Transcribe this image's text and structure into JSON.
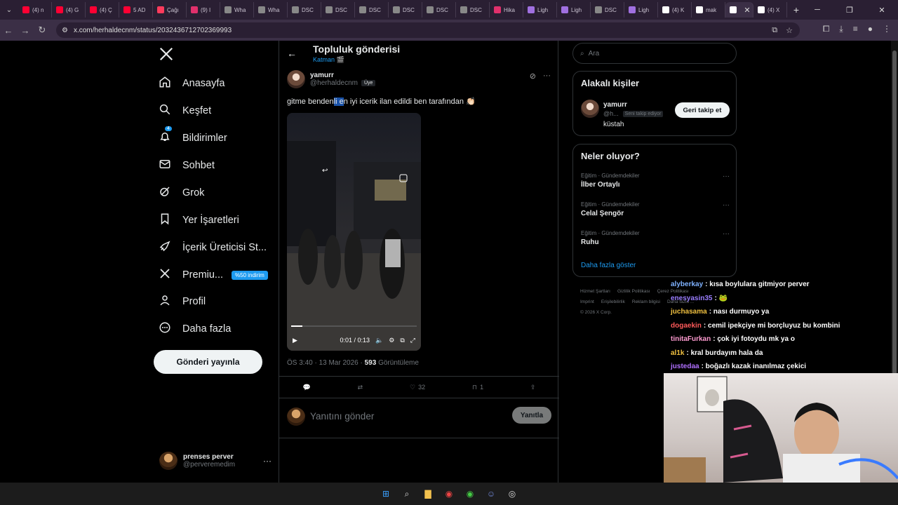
{
  "browser": {
    "tabs": [
      {
        "label": "(4) n",
        "color": "#ff0033"
      },
      {
        "label": "(4) G",
        "color": "#ff0033"
      },
      {
        "label": "(4) Ç",
        "color": "#ff0033"
      },
      {
        "label": "5 AD",
        "color": "#ff0033"
      },
      {
        "label": "Çağı",
        "color": "#ff3b5c"
      },
      {
        "label": "(9) I",
        "color": "#e1306c"
      },
      {
        "label": "Wha",
        "color": "#888888"
      },
      {
        "label": "Wha",
        "color": "#888888"
      },
      {
        "label": "DSC",
        "color": "#888888"
      },
      {
        "label": "DSC",
        "color": "#888888"
      },
      {
        "label": "DSC",
        "color": "#888888"
      },
      {
        "label": "DSC",
        "color": "#888888"
      },
      {
        "label": "DSC",
        "color": "#888888"
      },
      {
        "label": "DSC",
        "color": "#888888"
      },
      {
        "label": "Hika",
        "color": "#e1306c"
      },
      {
        "label": "Ligh",
        "color": "#a070e0"
      },
      {
        "label": "Ligh",
        "color": "#a070e0"
      },
      {
        "label": "DSC",
        "color": "#888888"
      },
      {
        "label": "Ligh",
        "color": "#a070e0"
      },
      {
        "label": "(4) K",
        "color": "#ffffff"
      },
      {
        "label": "mak",
        "color": "#ffffff"
      }
    ],
    "active_tab_label": "",
    "last_tab_label": "(4) X",
    "url": "x.com/herhaldecnm/status/2032436712702369993"
  },
  "nav": {
    "items": [
      {
        "label": "Anasayfa",
        "icon": "home-icon"
      },
      {
        "label": "Keşfet",
        "icon": "search-icon"
      },
      {
        "label": "Bildirimler",
        "icon": "bell-icon",
        "badge": "4"
      },
      {
        "label": "Sohbet",
        "icon": "mail-icon"
      },
      {
        "label": "Grok",
        "icon": "grok-icon"
      },
      {
        "label": "Yer İşaretleri",
        "icon": "bookmark-icon"
      },
      {
        "label": "İçerik Üreticisi St...",
        "icon": "rocket-icon"
      },
      {
        "label": "Premiu...",
        "icon": "x-icon",
        "pill": "%50 indirim"
      },
      {
        "label": "Profil",
        "icon": "person-icon"
      },
      {
        "label": "Daha fazla",
        "icon": "more-circle-icon"
      }
    ],
    "post_button": "Gönderi yayınla",
    "account": {
      "name": "prenses perver",
      "handle": "@perveremedim"
    }
  },
  "main": {
    "title": "Topluluk gönderisi",
    "subtitle": "Katman 🎬",
    "author": {
      "name": "yamurr",
      "handle": "@herhaldecnm",
      "member_badge": "Üye"
    },
    "text_before": "gitme benden",
    "text_selected": "li e",
    "text_after": "n iyi icerik ilan edildi ben tarafından 👏🏻",
    "video": {
      "time": "0:01 / 0:13",
      "progress": 0.09
    },
    "meta_time": "ÖS 3:40 · 13 Mar 2026 · ",
    "views": "593",
    "views_label": " Görüntüleme",
    "likes": "32",
    "bookmarks": "1",
    "reply_placeholder": "Yanıtını gönder",
    "reply_button": "Yanıtla"
  },
  "right": {
    "search_placeholder": "Ara",
    "related_title": "Alakalı kişiler",
    "person": {
      "name": "yamurr",
      "handle": "@h...",
      "follows_you": "Seni takip ediyor",
      "bio": "küstah",
      "button": "Geri takip et"
    },
    "trending_title": "Neler oluyor?",
    "trends": [
      {
        "category": "Eğitim · Gündemdekiler",
        "name": "İlber Ortaylı"
      },
      {
        "category": "Eğitim · Gündemdekiler",
        "name": "Celal Şengör"
      },
      {
        "category": "Eğitim · Gündemdekiler",
        "name": "Ruhu"
      }
    ],
    "show_more": "Daha fazla göster",
    "footer_line1": [
      "Hizmet Şartları",
      "Gizlilik Politikası",
      "Çerez Politikası"
    ],
    "footer_line2": [
      "Imprint",
      "Erişilebilirlik",
      "Reklam bilgisi",
      "Daha fazla ..."
    ],
    "copyright": "© 2026 X Corp."
  },
  "chat": [
    {
      "user": "alyberkay",
      "color": "#7fb2ff",
      "msg": ": kısa boylulara gitmiyor perver"
    },
    {
      "user": "enesyasin35",
      "color": "#9a7dff",
      "msg": ": 🐸"
    },
    {
      "user": "juchasama",
      "color": "#f0c040",
      "msg": ": nası durmuyo ya"
    },
    {
      "user": "dogaekin",
      "color": "#ff5a5a",
      "msg": ": cemil ipekçiye mi borçluyuz bu kombini"
    },
    {
      "user": "tinitaFurkan",
      "color": "#ff9bd0",
      "msg": ": çok iyi fotoydu mk ya o"
    },
    {
      "user": "al1k",
      "color": "#f0c040",
      "msg": ": kral burdayım hala da"
    },
    {
      "user": "justedaa",
      "color": "#b070ff",
      "msg": ": boğazlı kazak inanılmaz çekici"
    }
  ]
}
